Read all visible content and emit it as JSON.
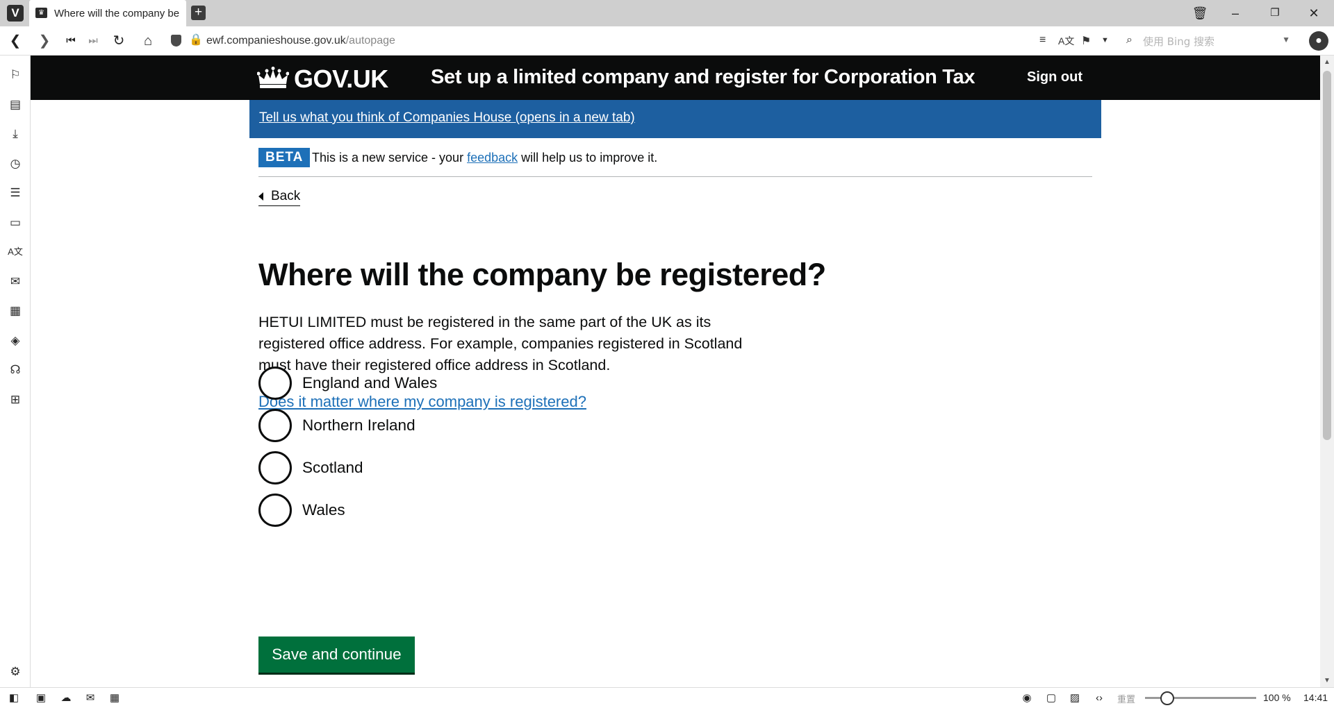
{
  "browser": {
    "logo": "V",
    "tab": {
      "title": "Where will the company be registered?",
      "favicon": "crown-icon"
    },
    "new_tab": "+",
    "window_controls": [
      "trash-icon",
      "minimize-icon",
      "restore-icon",
      "close-icon"
    ],
    "address": {
      "domain": "ewf.companieshouse.gov.uk",
      "path": "/autopage"
    },
    "search": {
      "placeholder": "使用 Bing 搜索"
    },
    "zoom_label": "重置",
    "zoom_value": "100 %",
    "zoom_level": 1.0,
    "clock": "14:41"
  },
  "header": {
    "logo_text": "GOV.UK",
    "service_name": "Set up a limited company and register for Corporation Tax",
    "sign_out": "Sign out"
  },
  "feedback_banner": {
    "link_text": "Tell us what you think of Companies House (opens in a new tab)"
  },
  "beta": {
    "tag": "BETA",
    "text_before": "This is a new service - your ",
    "link": "feedback",
    "text_after": " will help us to improve it."
  },
  "back_link": "Back",
  "main": {
    "heading": "Where will the company be registered?",
    "intro_lines": [
      "HETUI LIMITED must be registered in the same part of the UK as its",
      "registered office address. For example, companies registered in Scotland",
      "must have their registered office address in Scotland."
    ],
    "help_link": "Does it matter where my company is registered?",
    "options": [
      "England and Wales",
      "Northern Ireland",
      "Scotland",
      "Wales"
    ],
    "submit": "Save and continue"
  },
  "colors": {
    "header_bg": "#0b0c0c",
    "banner_bg": "#1d5fa0",
    "link": "#1d70b8",
    "button_green": "#00703c"
  }
}
